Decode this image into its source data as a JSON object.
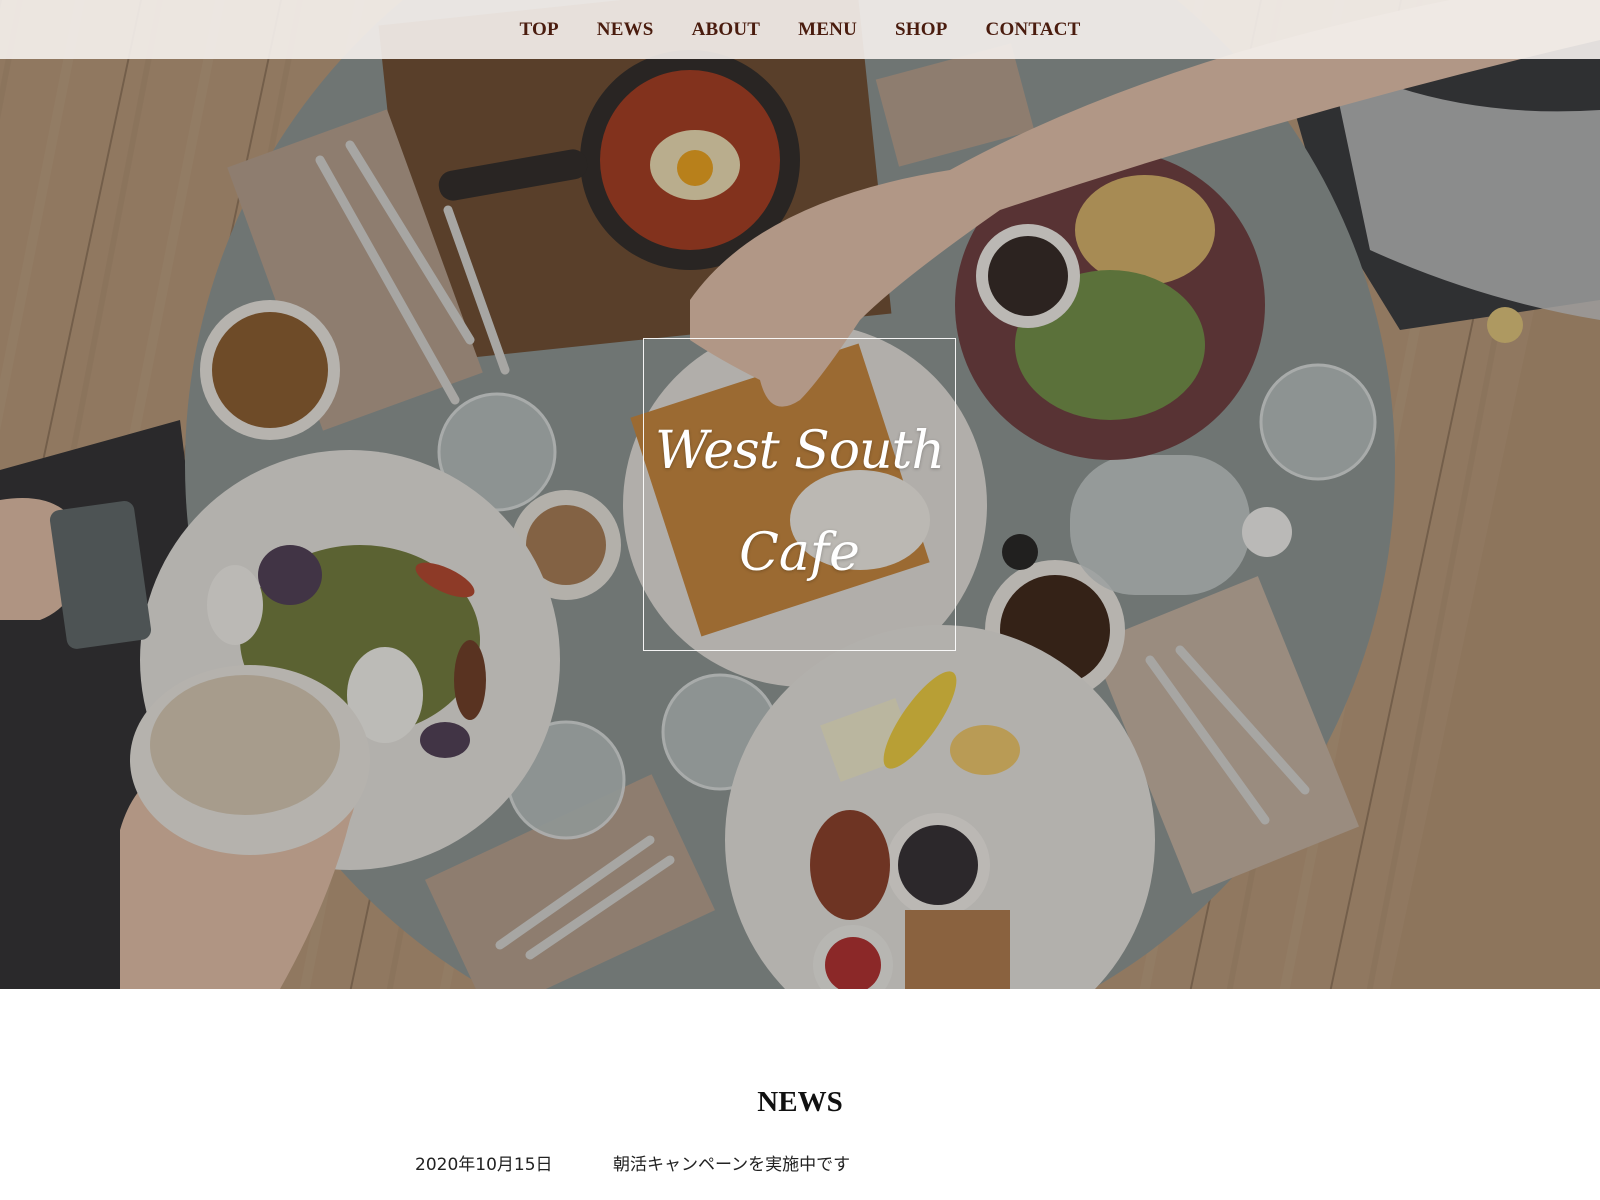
{
  "nav": {
    "items": [
      {
        "label": "TOP"
      },
      {
        "label": "NEWS"
      },
      {
        "label": "ABOUT"
      },
      {
        "label": "MENU"
      },
      {
        "label": "SHOP"
      },
      {
        "label": "CONTACT"
      }
    ]
  },
  "hero": {
    "logo_line1": "West South",
    "logo_line2": "Cafe",
    "image": "overhead cafe breakfast table photo"
  },
  "news": {
    "title": "NEWS",
    "items": [
      {
        "date": "2020年10月15日",
        "text": "朝活キャンペーンを実施中です"
      }
    ]
  },
  "colors": {
    "nav_text": "#4a1c0e",
    "nav_bg": "#f6f2ee",
    "table": "#8a9493",
    "floor": "#b19270"
  }
}
